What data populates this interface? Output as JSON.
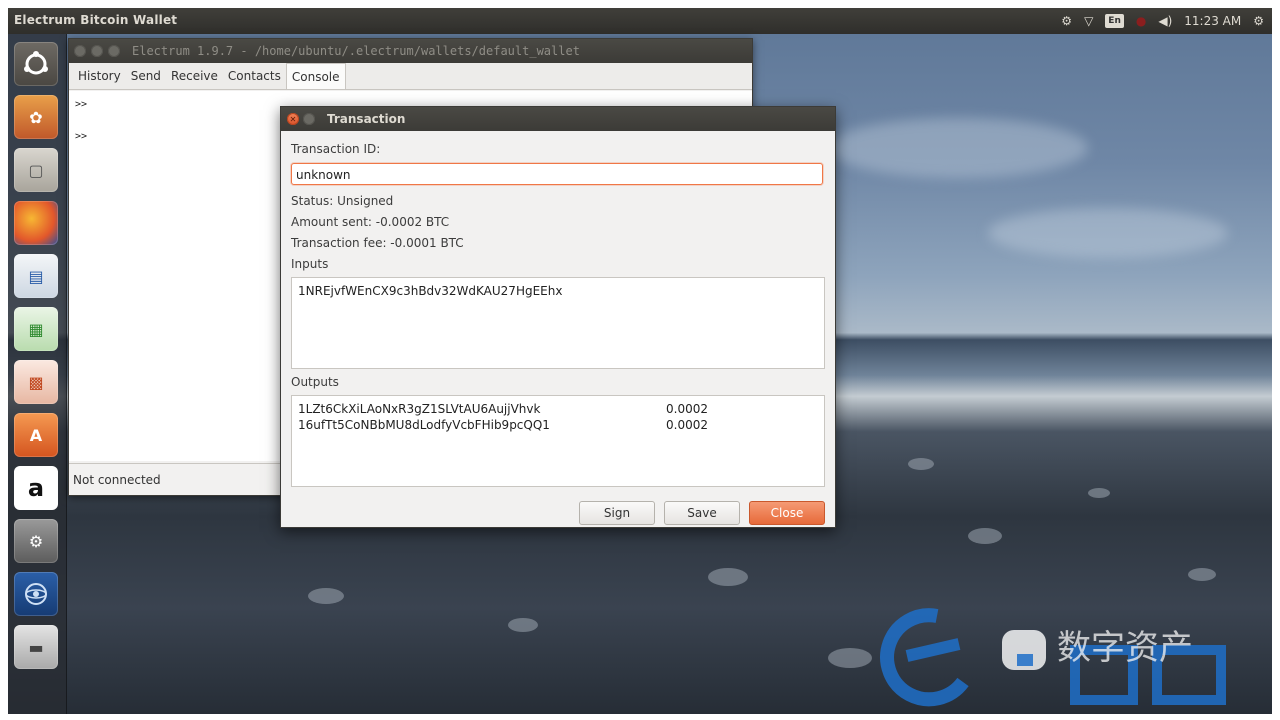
{
  "topbar": {
    "title": "Electrum Bitcoin Wallet",
    "keyboard": "En",
    "time": "11:23 AM"
  },
  "launcher": {
    "items": [
      {
        "name": "ubuntu-dash-icon"
      },
      {
        "name": "photos-icon"
      },
      {
        "name": "files-icon"
      },
      {
        "name": "firefox-icon"
      },
      {
        "name": "writer-icon"
      },
      {
        "name": "calc-icon"
      },
      {
        "name": "impress-icon"
      },
      {
        "name": "software-center-icon"
      },
      {
        "name": "amazon-icon"
      },
      {
        "name": "system-settings-icon"
      },
      {
        "name": "electrum-icon"
      },
      {
        "name": "scanner-icon"
      }
    ]
  },
  "electrum": {
    "window_title": "Electrum 1.9.7  -  /home/ubuntu/.electrum/wallets/default_wallet",
    "tabs": [
      "History",
      "Send",
      "Receive",
      "Contacts",
      "Console"
    ],
    "active_tab": "Console",
    "console_lines": [
      ">>",
      ">>"
    ],
    "status": "Not connected"
  },
  "dialog": {
    "title": "Transaction",
    "txid_label": "Transaction ID:",
    "txid_value": "unknown",
    "status": "Status: Unsigned",
    "amount_sent": "Amount sent: -0.0002 BTC",
    "fee": "Transaction fee: -0.0001 BTC",
    "inputs_label": "Inputs",
    "inputs": [
      "1NREjvfWEnCX9c3hBdv32WdKAU27HgEEhx"
    ],
    "outputs_label": "Outputs",
    "outputs": [
      {
        "address": "1LZt6CkXiLAoNxR3gZ1SLVtAU6AujjVhvk",
        "amount": "0.0002"
      },
      {
        "address": "16ufTt5CoNBbMU8dLodfyVcbFHib9pcQQ1",
        "amount": "0.0002"
      }
    ],
    "buttons": {
      "sign": "Sign",
      "save": "Save",
      "close": "Close"
    }
  },
  "watermark": {
    "text": "数字资产"
  },
  "colors": {
    "accent": "#e76a3a",
    "panel": "#3c3b37",
    "window_bg": "#f2f1f0",
    "watermark": "#1f6fc8"
  }
}
